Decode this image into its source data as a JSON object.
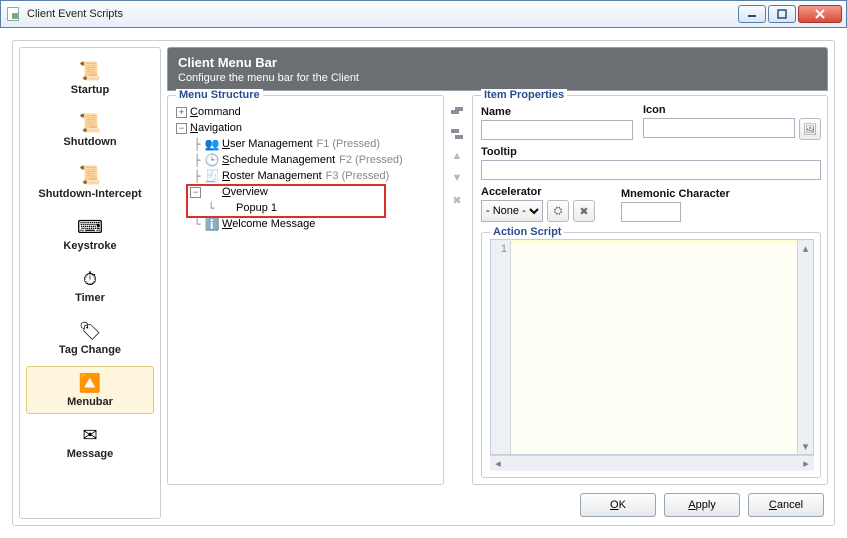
{
  "window": {
    "title": "Client Event Scripts"
  },
  "left_items": [
    {
      "id": "startup",
      "label": "Startup",
      "glyph": "📜"
    },
    {
      "id": "shutdown",
      "label": "Shutdown",
      "glyph": "📜"
    },
    {
      "id": "shutdown-intercept",
      "label": "Shutdown-Intercept",
      "glyph": "📜"
    },
    {
      "id": "keystroke",
      "label": "Keystroke",
      "glyph": "⌨"
    },
    {
      "id": "timer",
      "label": "Timer",
      "glyph": "⏱"
    },
    {
      "id": "tag-change",
      "label": "Tag Change",
      "glyph": "🏷"
    },
    {
      "id": "menubar",
      "label": "Menubar",
      "glyph": "🔼",
      "selected": true
    },
    {
      "id": "message",
      "label": "Message",
      "glyph": "✉"
    }
  ],
  "header": {
    "title": "Client Menu Bar",
    "subtitle": "Configure the menu bar for the Client"
  },
  "menu_structure": {
    "legend": "Menu Structure",
    "tree": {
      "command": {
        "label": "Command",
        "mnemonic": "C"
      },
      "navigation": {
        "label": "Navigation",
        "mnemonic": "N",
        "items": [
          {
            "id": "user-mgmt",
            "icon": "👥",
            "label": "User Management",
            "mnemonic": "U",
            "hint": "F1 (Pressed)"
          },
          {
            "id": "schedule-mgmt",
            "icon": "🕒",
            "label": "Schedule Management",
            "mnemonic": "S",
            "hint": "F2 (Pressed)"
          },
          {
            "id": "roster-mgmt",
            "icon": "🧾",
            "label": "Roster Management",
            "mnemonic": "R",
            "hint": "F3 (Pressed)"
          },
          {
            "id": "overview",
            "icon": "",
            "label": "Overview",
            "mnemonic": "O",
            "children": [
              {
                "id": "popup1",
                "label": "Popup 1"
              }
            ]
          },
          {
            "id": "welcome",
            "icon": "ℹ️",
            "label": "Welcome Message",
            "mnemonic": "W"
          }
        ]
      }
    }
  },
  "item_properties": {
    "legend": "Item Properties",
    "labels": {
      "name": "Name",
      "icon": "Icon",
      "tooltip": "Tooltip",
      "accelerator": "Accelerator",
      "mnemonic": "Mnemonic Character"
    },
    "values": {
      "name": "",
      "icon": "",
      "tooltip": "",
      "accelerator_selected": "- None -",
      "mnemonic": ""
    }
  },
  "action_script": {
    "legend": "Action Script",
    "line_count_visible": "1"
  },
  "buttons": {
    "ok": "OK",
    "apply": "Apply",
    "cancel": "Cancel"
  }
}
